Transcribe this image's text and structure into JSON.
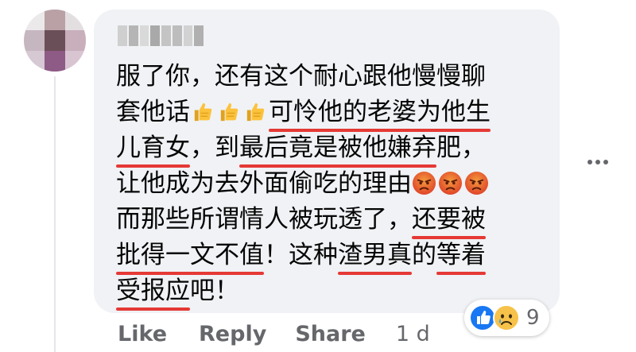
{
  "comment": {
    "lines": [
      [
        {
          "t": "服了你，还有这个耐心跟他慢慢聊",
          "u": false
        }
      ],
      [
        {
          "t": "套他话",
          "u": false
        },
        {
          "emoji": "thumbs-up-icon"
        },
        {
          "emoji": "thumbs-up-icon"
        },
        {
          "emoji": "thumbs-up-icon"
        },
        {
          "t": "可怜他的老婆为他生",
          "u": true
        }
      ],
      [
        {
          "t": "儿育女",
          "u": true
        },
        {
          "t": "，到",
          "u": false
        },
        {
          "t": "最后竟是被他嫌弃",
          "u": true
        },
        {
          "t": "肥，",
          "u": false
        }
      ],
      [
        {
          "t": "让他成为去外面偷吃的理由",
          "u": false
        },
        {
          "emoji": "angry-face-icon"
        },
        {
          "emoji": "angry-face-icon"
        },
        {
          "emoji": "angry-face-icon"
        }
      ],
      [
        {
          "t": "而那些所谓情人被玩透了，",
          "u": false
        },
        {
          "t": "还要被",
          "u": true
        }
      ],
      [
        {
          "t": "批得一文不值",
          "u": true
        },
        {
          "t": "！这种",
          "u": false
        },
        {
          "t": "渣男真",
          "u": true
        },
        {
          "t": "的",
          "u": false
        },
        {
          "t": "等着",
          "u": true
        }
      ],
      [
        {
          "t": "受报应",
          "u": true
        },
        {
          "t": "吧！",
          "u": false
        }
      ]
    ]
  },
  "actions": {
    "like": "Like",
    "reply": "Reply",
    "share": "Share",
    "time": "1 d"
  },
  "reactions": {
    "icons": [
      "like-reaction-icon",
      "sad-reaction-icon"
    ],
    "count": "9"
  },
  "colors": {
    "underline": "#e53935",
    "bubble": "#f0f2f5",
    "secondary_text": "#65676b"
  }
}
